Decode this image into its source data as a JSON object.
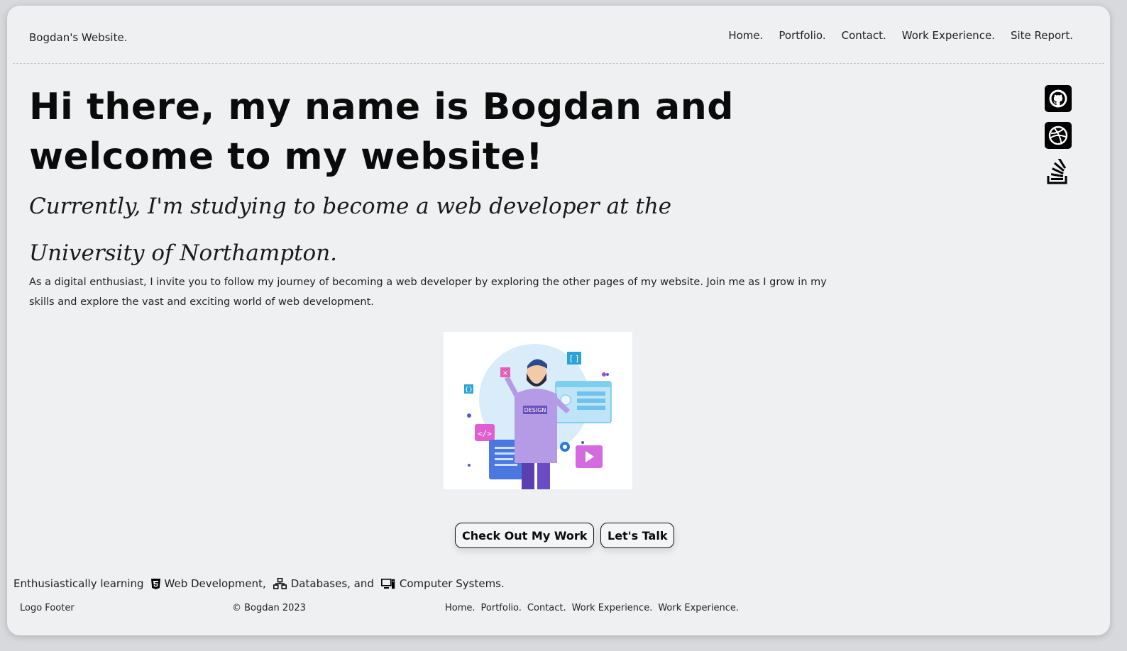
{
  "header": {
    "site_title": "Bogdan's Website.",
    "nav": [
      "Home.",
      "Portfolio.",
      "Contact.",
      "Work Experience.",
      "Site Report."
    ]
  },
  "hero": {
    "title_line1": "Hi there, my name is Bogdan and",
    "title_line2": "welcome to my website!",
    "subtitle": "Currently, I'm studying to become a web developer at the University of Northampton.",
    "description": "As a digital enthusiast, I invite you to follow my journey of becoming a web developer by exploring the other pages of my website. Join me as I grow in my skills and explore the vast and exciting world of web development."
  },
  "socials": [
    "github-icon",
    "dribbble-icon",
    "stackoverflow-icon"
  ],
  "illustration": {
    "badge_text": "DESIGN"
  },
  "buttons": {
    "work": "Check Out My Work",
    "talk": "Let's Talk"
  },
  "skills": {
    "intro": "Enthusiastically learning",
    "items": [
      "Web Development,",
      "Databases, and",
      "Computer Systems."
    ]
  },
  "footer": {
    "logo": "Logo Footer",
    "copyright": "© Bogdan 2023",
    "links": [
      "Home.",
      "Portfolio.",
      "Contact.",
      "Work Experience.",
      "Work Experience."
    ]
  },
  "colors": {
    "page_bg": "#eef0f2",
    "text": "#0b0b0b",
    "accent_purple": "#b89be8",
    "accent_blue": "#48b7e0",
    "accent_pink": "#e060c8"
  }
}
